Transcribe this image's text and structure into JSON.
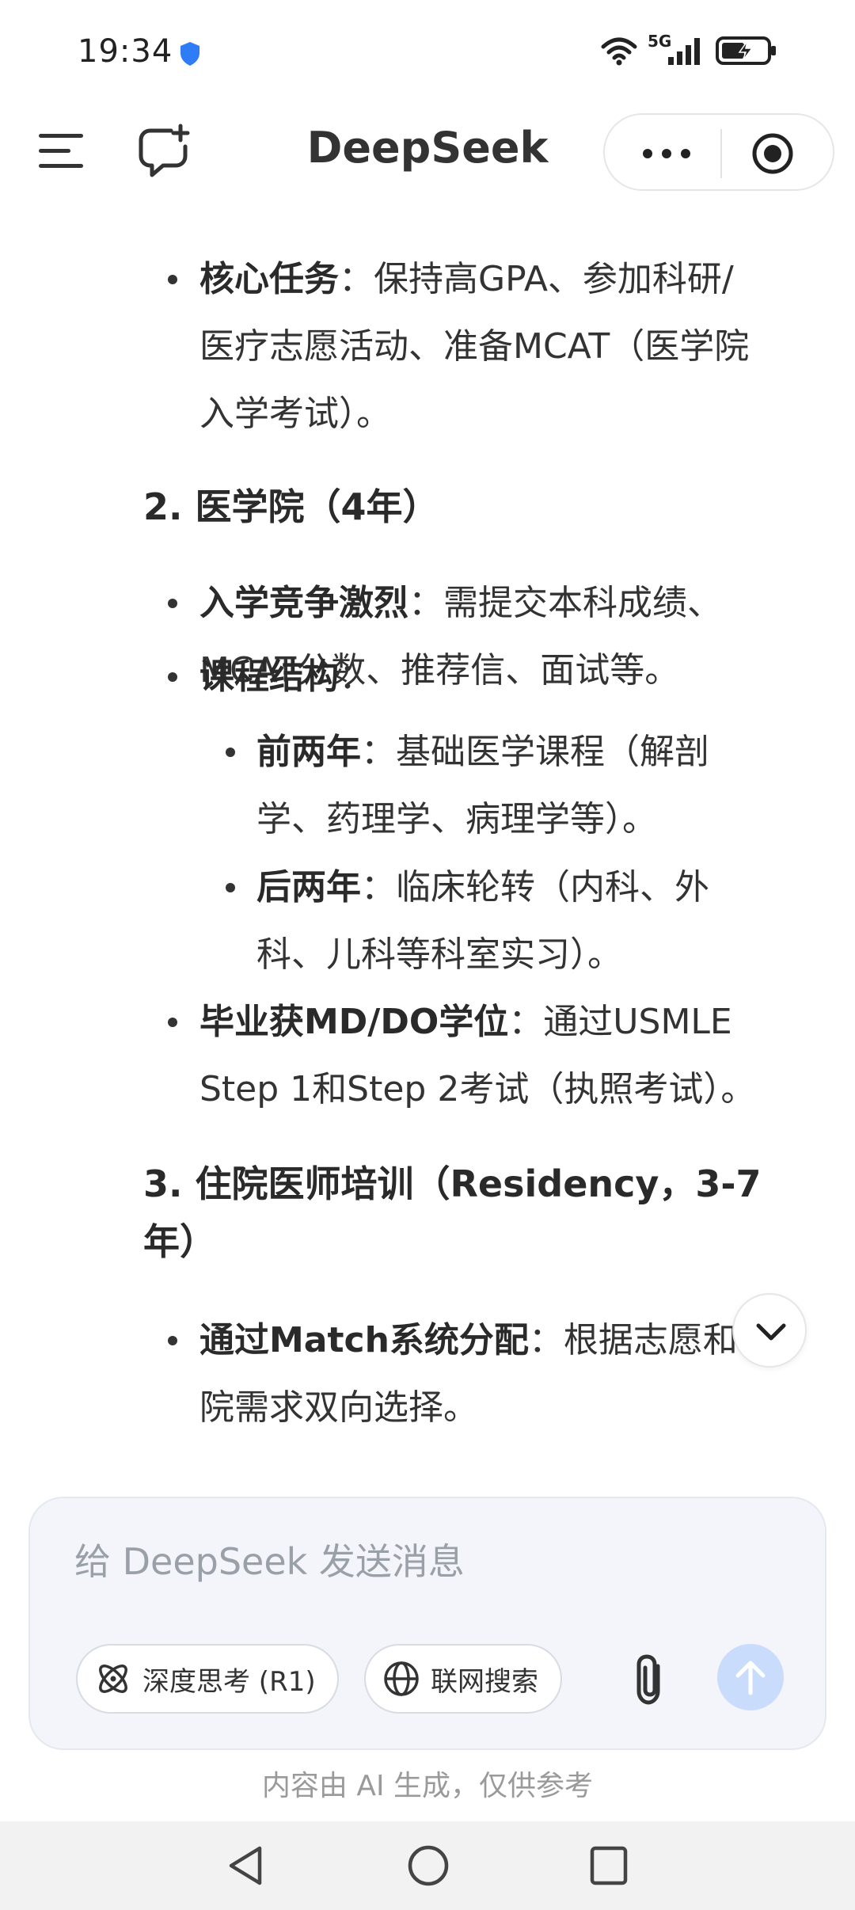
{
  "status_bar": {
    "time": "19:34",
    "network": "5G",
    "icons": [
      "shield-icon",
      "wifi-icon",
      "signal-icon",
      "battery-charging-icon"
    ]
  },
  "header": {
    "title": "DeepSeek",
    "icons": [
      "menu-icon",
      "new-chat-icon",
      "more-icon",
      "record-icon"
    ]
  },
  "content": {
    "bullet_1_strong": "核心任务",
    "bullet_1_lines": [
      "：保持高GPA、参加科研/",
      "医疗志愿活动、准备MCAT（医学院",
      "入学考试）。"
    ],
    "section_2": "2. 医学院（4年）",
    "bullet_2_strong": "入学竞争激烈",
    "bullet_2_lines": [
      "：需提交本科成绩、",
      "MCAT分数、推荐信、面试等。"
    ],
    "bullet_3_strong": "课程结构",
    "bullet_3_rest": "：",
    "sub_1_strong": "前两年",
    "sub_1_lines": [
      "：基础医学课程（解剖",
      "学、药理学、病理学等）。"
    ],
    "sub_2_strong": "后两年",
    "sub_2_lines": [
      "：临床轮转（内科、外",
      "科、儿科等科室实习）。"
    ],
    "bullet_4_strong": "毕业获MD/DO学位",
    "bullet_4_lines": [
      "：通过USMLE",
      "Step 1和Step 2考试（执照考试）。"
    ],
    "section_3_lines": [
      "3. 住院医师培训（Residency，3-7",
      "年）"
    ],
    "bullet_5_strong": "通过Match系统分配",
    "bullet_5_lines": [
      "：根据志愿和医",
      "院需求双向选择。"
    ]
  },
  "composer": {
    "placeholder": "给 DeepSeek 发送消息",
    "deep_think_label": "深度思考 (R1)",
    "web_search_label": "联网搜索"
  },
  "disclaimer": "内容由 AI 生成，仅供参考",
  "colors": {
    "send_button": "#c9dcfb",
    "composer_bg": "#f3f5fa",
    "text": "#333333"
  }
}
